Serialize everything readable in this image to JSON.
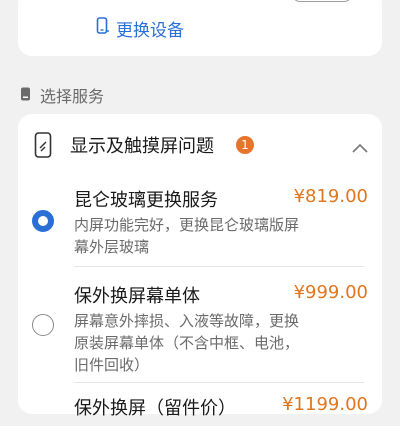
{
  "device": {
    "change_device_label": "更换设备"
  },
  "section": {
    "label": "选择服务"
  },
  "category": {
    "title": "显示及触摸屏问题",
    "badge_count": "1"
  },
  "options": [
    {
      "name": "昆仑玻璃更换服务",
      "price": "¥819.00",
      "description": "内屏功能完好，更换昆仑玻璃版屏幕外层玻璃",
      "selected": true
    },
    {
      "name": "保外换屏幕单体",
      "price": "¥999.00",
      "description": "屏幕意外摔损、入液等故障，更换原装屏幕单体（不含中框、电池，旧件回收）",
      "selected": false
    },
    {
      "name": "保外换屏（留件价）",
      "price": "¥1199.00",
      "selected": false
    }
  ],
  "colors": {
    "accent": "#2a6fd6",
    "price": "#e0771f",
    "badge": "#e8742a",
    "background": "#f1f1f1"
  },
  "icons": {
    "change_device": "phone-icon",
    "section": "phone-icon",
    "category": "screen-icon",
    "collapse": "chevron-up-icon"
  }
}
